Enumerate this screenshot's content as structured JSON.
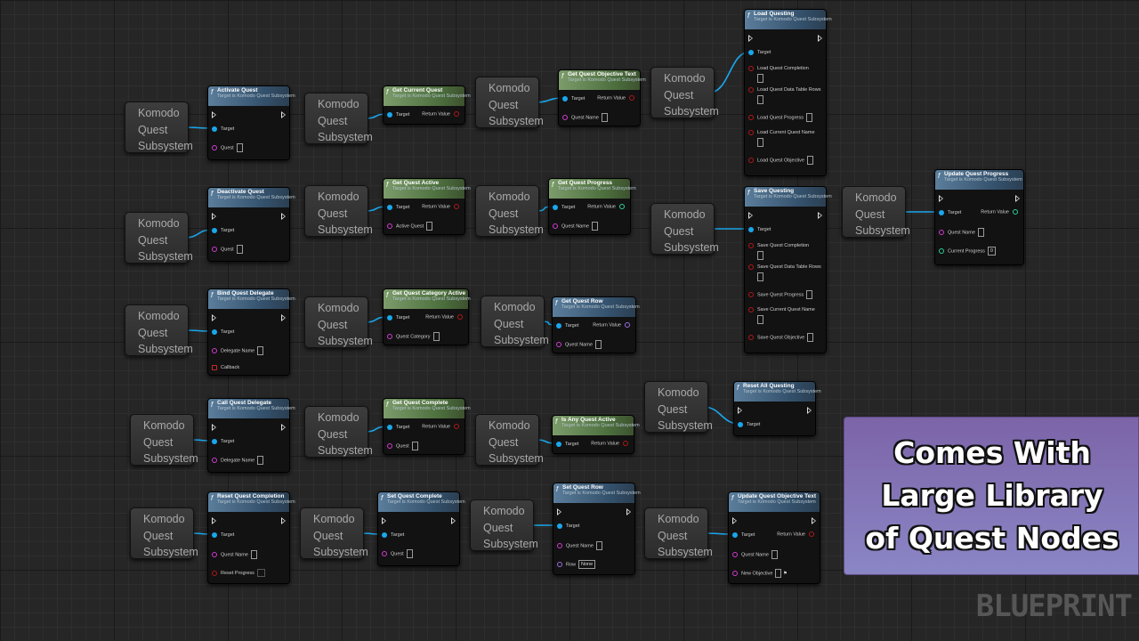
{
  "subsystem_label": [
    "Komodo",
    "Quest",
    "Subsystem"
  ],
  "colors": {
    "exec": "#dddddd",
    "target": "#1aa7ec",
    "string": "#d33bd1",
    "bool": "#b01818",
    "int": "#2bd496",
    "struct": "#9a6fe0",
    "wire": "#1aa7ec"
  },
  "labels": {
    "func_icon": "f",
    "target": "Target",
    "return_value": "Return Value",
    "target_is": "Target is Komodo Quest Subsystem",
    "none_value": "None",
    "zero_value": "0"
  },
  "nodes": [
    {
      "title": "Activate Quest",
      "pins": [
        "Quest"
      ]
    },
    {
      "title": "Deactivate Quest",
      "pins": [
        "Quest"
      ]
    },
    {
      "title": "Bind Quest Delegate",
      "pins": [
        "Delegate Name",
        "Callback"
      ]
    },
    {
      "title": "Call Quest Delegate",
      "pins": [
        "Delegate Name"
      ]
    },
    {
      "title": "Reset Quest Completion",
      "pins": [
        "Quest Name",
        "Reset Progress"
      ]
    },
    {
      "title": "Get Current Quest",
      "pins": []
    },
    {
      "title": "Get Quest Active",
      "pins": [
        "Active Quest"
      ]
    },
    {
      "title": "Get Quest Category Active",
      "pins": [
        "Quest Category"
      ]
    },
    {
      "title": "Get Quest Complete",
      "pins": [
        "Quest"
      ]
    },
    {
      "title": "Set Quest Complete",
      "pins": [
        "Quest"
      ]
    },
    {
      "title": "Get Quest Objective Text",
      "pins": [
        "Quest Name"
      ]
    },
    {
      "title": "Get Quest Progress",
      "pins": [
        "Quest Name"
      ]
    },
    {
      "title": "Get Quest Row",
      "pins": [
        "Quest Name"
      ]
    },
    {
      "title": "Is Any Quest Active",
      "pins": []
    },
    {
      "title": "Set Quest Row",
      "pins": [
        "Quest Name",
        "Row"
      ]
    },
    {
      "title": "Load Questing",
      "pins": [
        "Load Quest Completion",
        "Load Quest Data Table Rows",
        "Load Quest Progress",
        "Load Current Quest Name",
        "Load Quest Objective"
      ]
    },
    {
      "title": "Save Questing",
      "pins": [
        "Save Quest Completion",
        "Save Quest Data Table Rows",
        "Save Quest Progress",
        "Save Current Quest Name",
        "Save Quest Objective"
      ]
    },
    {
      "title": "Reset All Questing",
      "pins": []
    },
    {
      "title": "Update Quest Objective Text",
      "pins": [
        "Quest Name",
        "New Objective"
      ]
    },
    {
      "title": "Update Quest Progress",
      "pins": [
        "Quest Name",
        "Current Progress"
      ]
    }
  ],
  "promo": {
    "line1": "Comes With",
    "line2": "Large Library",
    "line3": "of Quest Nodes"
  },
  "watermark": "BLUEPRINT"
}
